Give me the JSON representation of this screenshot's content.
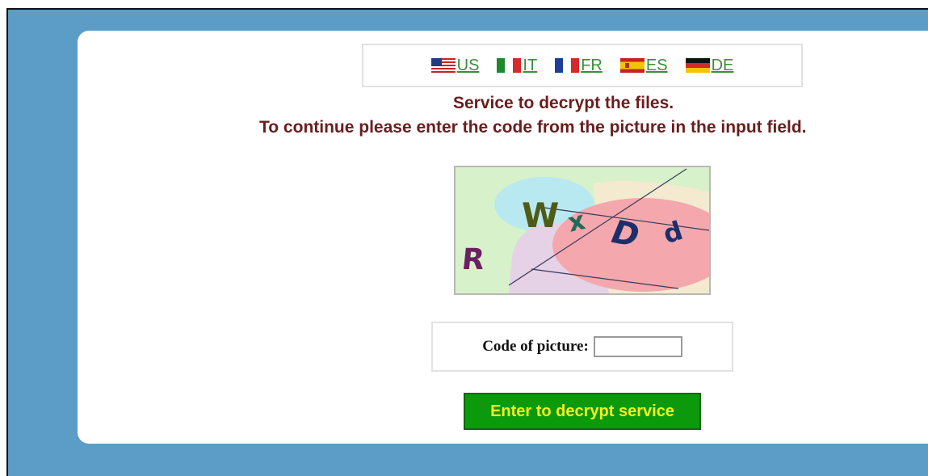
{
  "languages": [
    {
      "code": "US",
      "flag": "us-flag"
    },
    {
      "code": "IT",
      "flag": "italy-flag"
    },
    {
      "code": "FR",
      "flag": "france-flag"
    },
    {
      "code": "ES",
      "flag": "spain-flag"
    },
    {
      "code": "DE",
      "flag": "germany-flag"
    }
  ],
  "headline": {
    "line1": "Service to decrypt the files.",
    "line2": "To continue please enter the code from the picture in the input field."
  },
  "captcha": {
    "chars": [
      "R",
      "W",
      "x",
      "D",
      "d"
    ]
  },
  "form": {
    "code_label": "Code of picture:",
    "code_value": "",
    "submit_label": "Enter to decrypt service"
  },
  "colors": {
    "background": "#5b9dc6",
    "headline": "#6b1d1d",
    "link": "#3a8f3a",
    "button_bg": "#0b9a0b",
    "button_text": "#f5ef20"
  }
}
